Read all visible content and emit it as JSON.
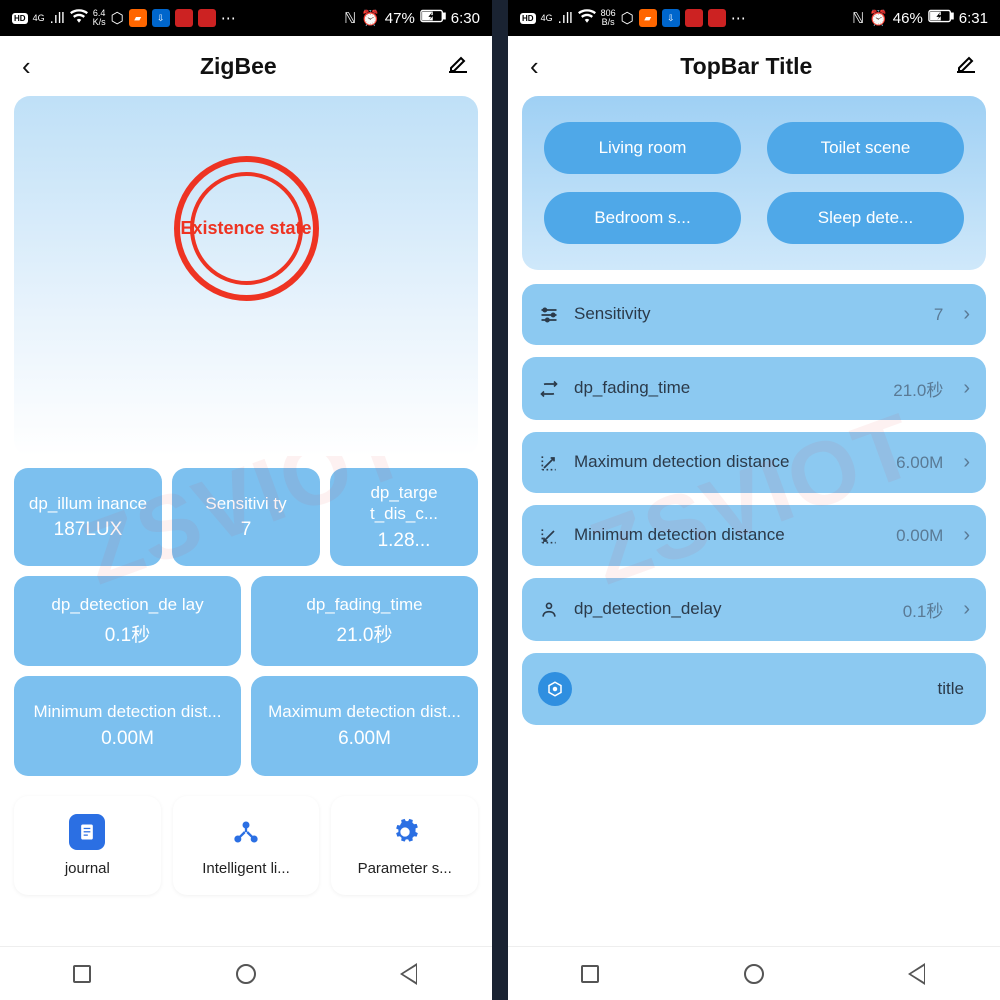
{
  "left": {
    "status": {
      "net": "6.4",
      "net_unit": "K/s",
      "battery": "47%",
      "time": "6:30"
    },
    "title": "ZigBee",
    "hero_label": "Existence state",
    "small": [
      {
        "label": "dp_illum inance",
        "value": "187LUX"
      },
      {
        "label": "Sensitivi ty",
        "value": "7"
      },
      {
        "label": "dp_targe t_dis_c...",
        "value": "1.28..."
      }
    ],
    "mid": [
      {
        "label": "dp_detection_de lay",
        "value": "0.1秒"
      },
      {
        "label": "dp_fading_time",
        "value": "21.0秒"
      }
    ],
    "big": [
      {
        "label": "Minimum detection dist...",
        "value": "0.00M"
      },
      {
        "label": "Maximum detection dist...",
        "value": "6.00M"
      }
    ],
    "bottom": [
      {
        "label": "journal",
        "color": "#2b6fe3"
      },
      {
        "label": "Intelligent li...",
        "color": "#2b6fe3"
      },
      {
        "label": "Parameter s...",
        "color": "#2b6fe3"
      }
    ]
  },
  "right": {
    "status": {
      "net": "806",
      "net_unit": "B/s",
      "battery": "46%",
      "time": "6:31"
    },
    "title": "TopBar Title",
    "scenes": [
      "Living room",
      "Toilet scene",
      "Bedroom s...",
      "Sleep dete..."
    ],
    "rows": [
      {
        "label": "Sensitivity",
        "value": "7"
      },
      {
        "label": "dp_fading_time",
        "value": "21.0秒"
      },
      {
        "label": "Maximum detection distance",
        "value": "6.00M"
      },
      {
        "label": "Minimum detection distance",
        "value": "0.00M"
      },
      {
        "label": "dp_detection_delay",
        "value": "0.1秒"
      }
    ],
    "extra_label": "title"
  }
}
